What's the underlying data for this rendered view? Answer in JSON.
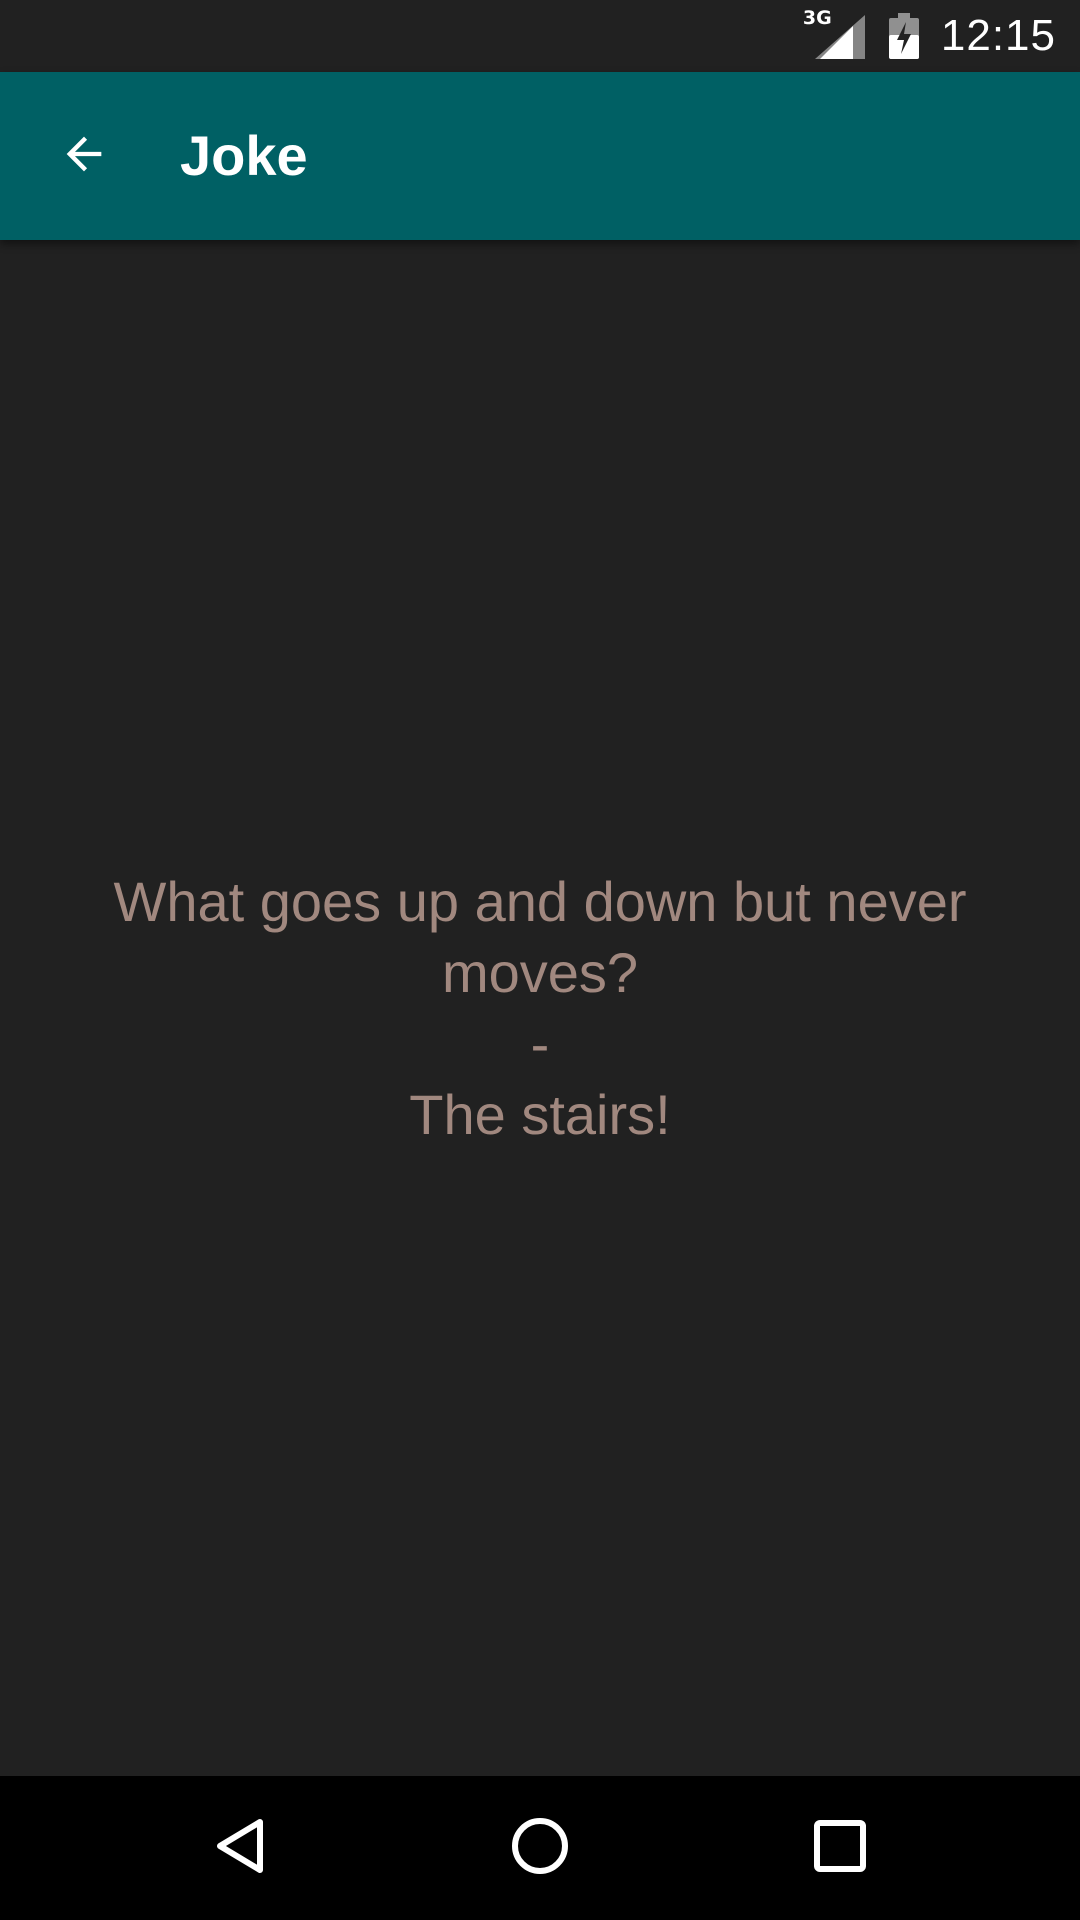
{
  "status_bar": {
    "network_label": "3G",
    "time": "12:15",
    "icons": [
      "signal-icon",
      "battery-charging-icon"
    ]
  },
  "app_bar": {
    "title": "Joke",
    "back_icon": "arrow-back-icon",
    "background": "#006064"
  },
  "joke": {
    "question": "What goes up and down but never moves?",
    "separator": "-",
    "answer": "The stairs!",
    "text_color": "#a1887f"
  },
  "nav_bar": {
    "icons": [
      "back-triangle-icon",
      "home-circle-icon",
      "recents-square-icon"
    ]
  },
  "colors": {
    "background": "#212121",
    "accent": "#006064",
    "text": "#a1887f"
  }
}
